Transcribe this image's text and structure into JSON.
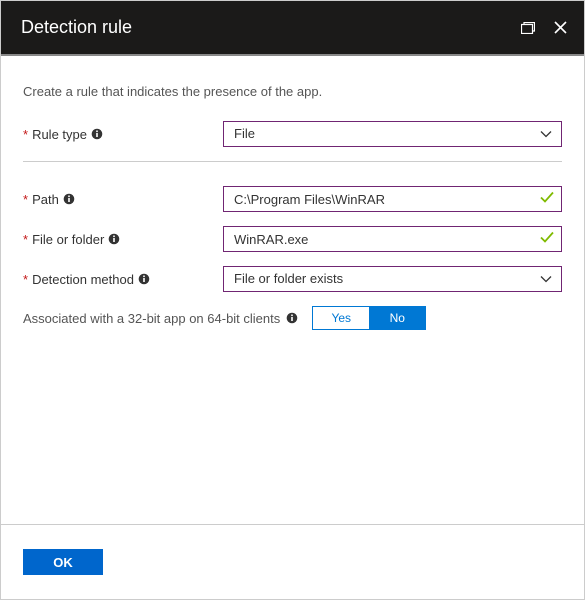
{
  "header": {
    "title": "Detection rule"
  },
  "content": {
    "description": "Create a rule that indicates the presence of the app.",
    "fields": {
      "ruleType": {
        "label": "Rule type",
        "value": "File"
      },
      "path": {
        "label": "Path",
        "value": "C:\\Program Files\\WinRAR"
      },
      "fileOrFolder": {
        "label": "File or folder",
        "value": "WinRAR.exe"
      },
      "detectionMethod": {
        "label": "Detection method",
        "value": "File or folder exists"
      }
    },
    "assoc": {
      "label": "Associated with a 32-bit app on 64-bit clients",
      "yes": "Yes",
      "no": "No",
      "selected": "No"
    }
  },
  "footer": {
    "ok": "OK"
  }
}
